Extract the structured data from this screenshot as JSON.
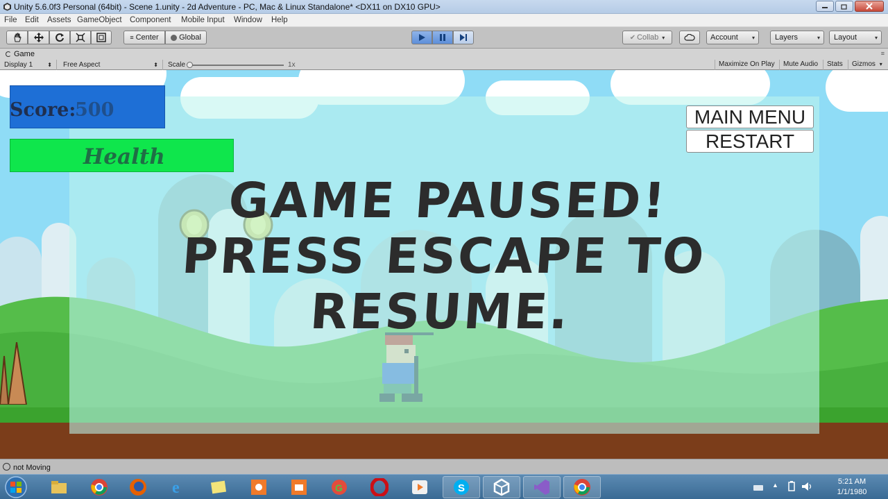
{
  "window": {
    "title": "Unity 5.6.0f3 Personal (64bit) - Scene 1.unity - 2d Adventure - PC, Mac & Linux Standalone* <DX11 on DX10 GPU>"
  },
  "menu": [
    "File",
    "Edit",
    "Assets",
    "GameObject",
    "Component",
    "Mobile Input",
    "Window",
    "Help"
  ],
  "toolbar": {
    "pivot_center": "Center",
    "pivot_global": "Global",
    "collab": "Collab",
    "account": "Account",
    "layers": "Layers",
    "layout": "Layout"
  },
  "game_view": {
    "tab_label": "Game",
    "display": "Display 1",
    "aspect": "Free Aspect",
    "scale_label": "Scale",
    "scale_value": "1x",
    "maximize_on_play": "Maximize On Play",
    "mute_audio": "Mute Audio",
    "stats": "Stats",
    "gizmos": "Gizmos"
  },
  "game_ui": {
    "score_label": "Score:",
    "score_value": "500",
    "health_label": "Health",
    "main_menu": "MAIN MENU",
    "restart": "RESTART",
    "pause_line1": "GAME PAUSED!",
    "pause_line2": "PRESS ESCAPE TO",
    "pause_line3": "RESUME."
  },
  "status": {
    "message": "not Moving"
  },
  "taskbar": {
    "time": "5:21 AM",
    "date": "1/1/1980"
  },
  "colors": {
    "sky": "#8fdcf6",
    "score_panel": "#1e6fd6",
    "health_bar": "#0fe64c",
    "pause_text": "#2c2c2c",
    "grass": "#3ba32e",
    "dirt": "#7b3d1a"
  }
}
